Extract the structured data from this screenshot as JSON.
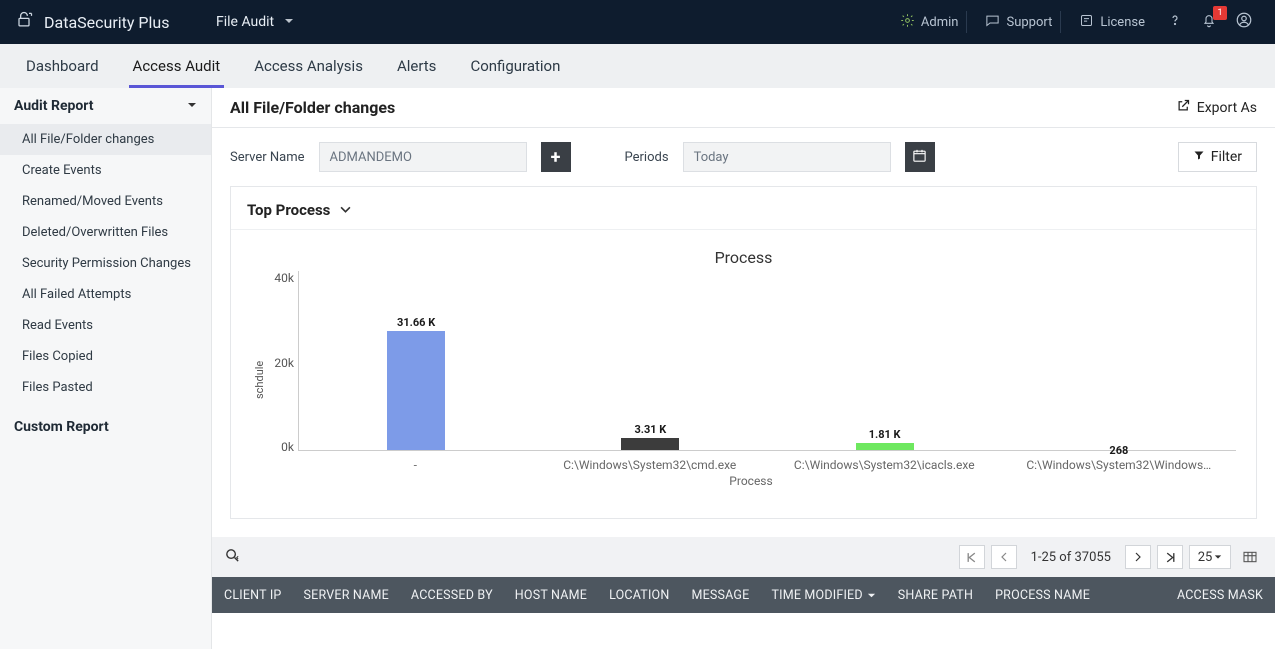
{
  "brand": "DataSecurity Plus",
  "topMenuLabel": "File Audit",
  "topRight": {
    "admin": "Admin",
    "support": "Support",
    "license": "License",
    "badge": "1"
  },
  "tabs": [
    "Dashboard",
    "Access Audit",
    "Access Analysis",
    "Alerts",
    "Configuration"
  ],
  "activeTab": 1,
  "sidebar": {
    "header": "Audit Report",
    "items": [
      "All File/Folder changes",
      "Create Events",
      "Renamed/Moved Events",
      "Deleted/Overwritten Files",
      "Security Permission Changes",
      "All Failed Attempts",
      "Read Events",
      "Files Copied",
      "Files Pasted"
    ],
    "activeItem": 0,
    "custom": "Custom Report"
  },
  "page": {
    "title": "All File/Folder changes",
    "export": "Export As"
  },
  "filters": {
    "serverLabel": "Server Name",
    "serverValue": "ADMANDEMO",
    "periodLabel": "Periods",
    "periodValue": "Today",
    "filterBtn": "Filter"
  },
  "chart_card": {
    "title": "Top Process"
  },
  "chart_data": {
    "type": "bar",
    "title": "Process",
    "xlabel": "Process",
    "ylabel": "schdule",
    "ylim": [
      0,
      40000
    ],
    "yticks": [
      "40k",
      "20k",
      "0k"
    ],
    "categories": [
      "-",
      "C:\\Windows\\System32\\cmd.exe",
      "C:\\Windows\\System32\\icacls.exe",
      "C:\\Windows\\System32\\Windows…"
    ],
    "series": [
      {
        "label": "31.66 K",
        "value": 31660,
        "color": "#7d9be8"
      },
      {
        "label": "3.31 K",
        "value": 3310,
        "color": "#3c3c3c"
      },
      {
        "label": "1.81 K",
        "value": 1810,
        "color": "#6ee85f"
      },
      {
        "label": "268",
        "value": 268,
        "color": "#ffffff"
      }
    ]
  },
  "table": {
    "pageSize": "25",
    "range": "1-25 of 37055",
    "columns": [
      "CLIENT IP",
      "SERVER NAME",
      "ACCESSED BY",
      "HOST NAME",
      "LOCATION",
      "MESSAGE",
      "TIME MODIFIED",
      "SHARE PATH",
      "PROCESS NAME",
      "ACCESS MASK"
    ],
    "sortCol": 6
  }
}
